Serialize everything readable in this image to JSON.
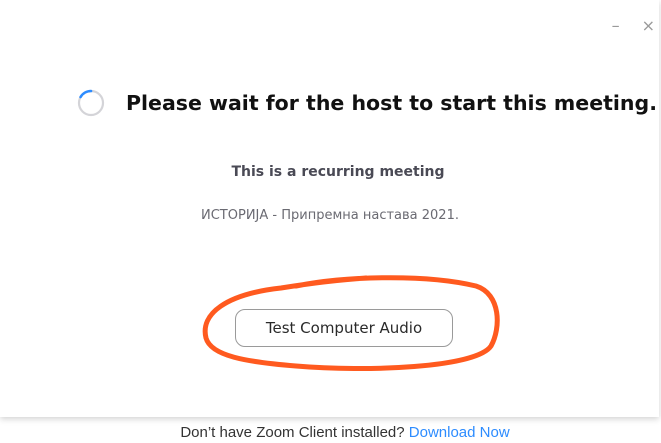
{
  "window": {
    "minimize_symbol": "–",
    "close_symbol": "×"
  },
  "status": {
    "title": "Please wait for the host to start this meeting.",
    "spinner_icon": "loading-spinner-icon"
  },
  "meeting": {
    "recurring_text": "This is a recurring meeting",
    "name": "ИСТОРИЈА - Припремна настава 2021."
  },
  "actions": {
    "test_audio_label": "Test Computer Audio"
  },
  "footer": {
    "prompt": "Don’t have Zoom Client installed?",
    "download_link": "Download Now"
  },
  "colors": {
    "link": "#2d8cff",
    "spinner": "#2d8cff",
    "annotation": "#ff5a1f"
  }
}
